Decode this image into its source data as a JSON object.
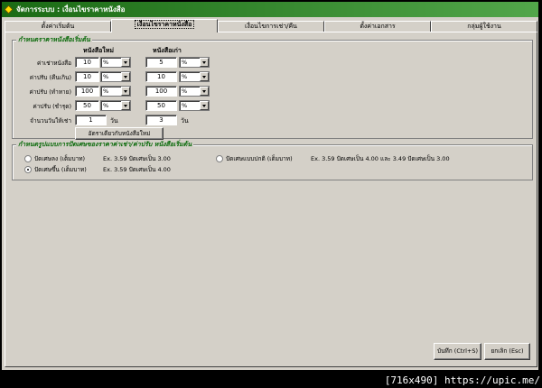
{
  "window": {
    "title": "จัดการระบบ : เงื่อนไขราคาหนังสือ"
  },
  "tabs": [
    {
      "label": "ตั้งค่าเริ่มต้น"
    },
    {
      "label": "เงื่อนไขราคาหนังสือ"
    },
    {
      "label": "เงื่อนไขการเช่า/คืน"
    },
    {
      "label": "ตั้งค่าเอกสาร"
    },
    {
      "label": "กลุ่มผู้ใช้งาน"
    }
  ],
  "active_tab": 1,
  "price_group": {
    "legend": "กำหนดราคาหนังสือเริ่มต้น",
    "col_new": "หนังสือใหม่",
    "col_old": "หนังสือเก่า",
    "rows": [
      {
        "label": "ค่าเช่าหนังสือ",
        "new_value": "10",
        "new_unit": "%",
        "old_value": "5",
        "old_unit": "%"
      },
      {
        "label": "ค่าปรับ (คืนเกิน)",
        "new_value": "10",
        "new_unit": "%",
        "old_value": "10",
        "old_unit": "%"
      },
      {
        "label": "ค่าปรับ (ทำหาย)",
        "new_value": "100",
        "new_unit": "%",
        "old_value": "100",
        "old_unit": "%"
      },
      {
        "label": "ค่าปรับ (ชำรุด)",
        "new_value": "50",
        "new_unit": "%",
        "old_value": "50",
        "old_unit": "%"
      }
    ],
    "days_label": "จำนวนวันให้เช่า",
    "days_new": "1",
    "days_old": "3",
    "days_unit": "วัน",
    "same_button": "อัตราเดียวกับหนังสือใหม่"
  },
  "rounding_group": {
    "legend": "กำหนดรูปแบบการปัดเศษของราคาค่าเช่า/ค่าปรับ หนังสือเริ่มต้น",
    "options": [
      {
        "label": "ปัดเศษลง (เต็มบาท)",
        "example": "Ex. 3.59 ปัดเศษเป็น 3.00",
        "selected": false
      },
      {
        "label": "ปัดเศษขึ้น (เต็มบาท)",
        "example": "Ex. 3.59 ปัดเศษเป็น 4.00",
        "selected": true
      },
      {
        "label": "ปัดเศษแบบปกติ (เต็มบาท)",
        "example": "Ex. 3.59 ปัดเศษเป็น 4.00 และ 3.49 ปัดเศษเป็น 3.00",
        "selected": false
      }
    ]
  },
  "footer": {
    "save_label": "บันทึก (Ctrl+S)",
    "cancel_label": "ยกเลิก (Esc)"
  },
  "watermark": "[716x490] https://upic.me/"
}
